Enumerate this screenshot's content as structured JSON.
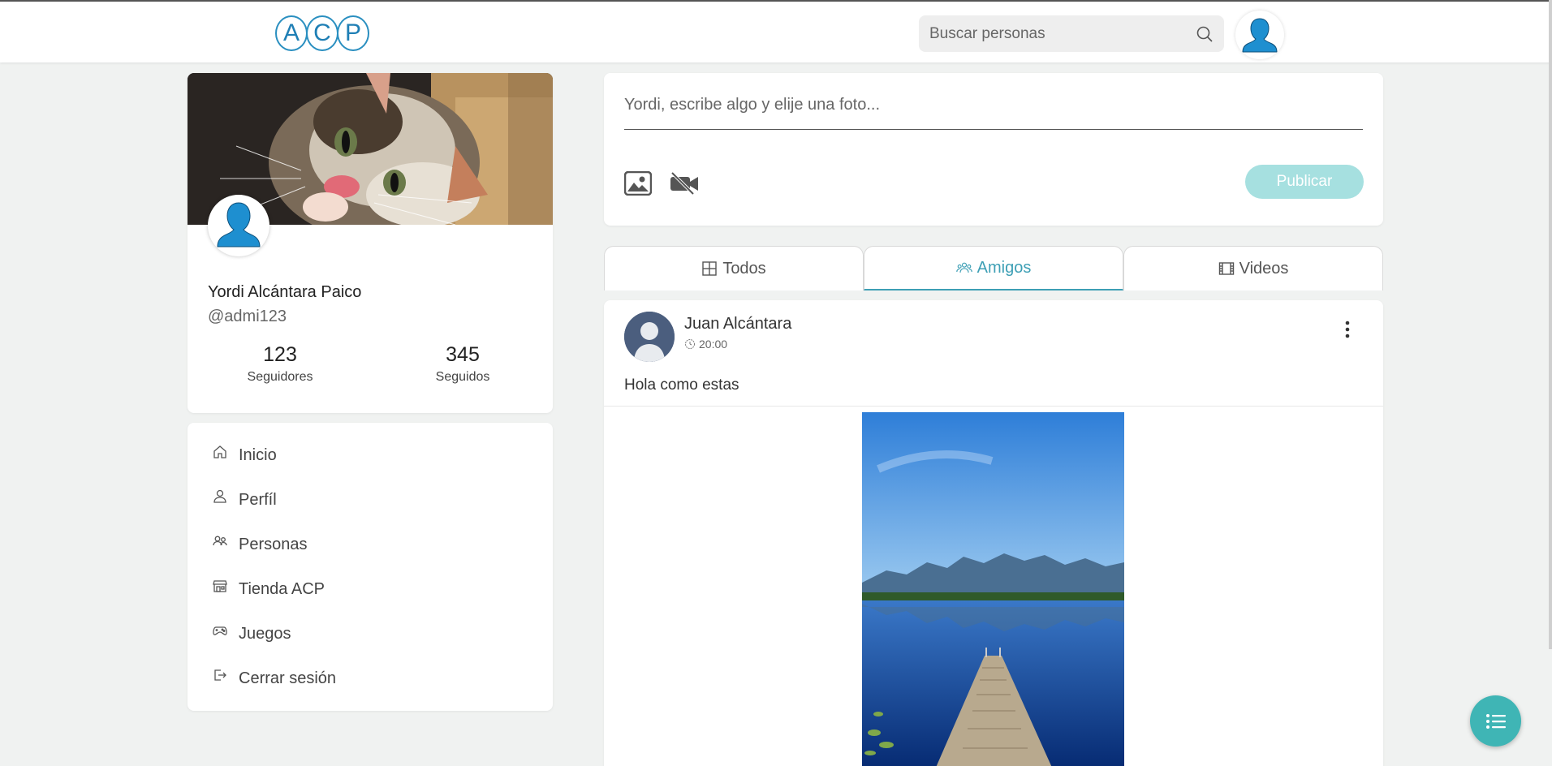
{
  "header": {
    "logo_letters": [
      "A",
      "C",
      "P"
    ],
    "search_placeholder": "Buscar personas"
  },
  "profile": {
    "name": "Yordi Alcántara Paico",
    "handle": "@admi123",
    "followers_count": "123",
    "followers_label": "Seguidores",
    "following_count": "345",
    "following_label": "Seguidos"
  },
  "menu": {
    "items": [
      {
        "label": "Inicio",
        "icon": "home-icon"
      },
      {
        "label": "Perfíl",
        "icon": "user-icon"
      },
      {
        "label": "Personas",
        "icon": "people-icon"
      },
      {
        "label": "Tienda ACP",
        "icon": "store-icon"
      },
      {
        "label": "Juegos",
        "icon": "gamepad-icon"
      },
      {
        "label": "Cerrar sesión",
        "icon": "logout-icon"
      }
    ]
  },
  "composer": {
    "placeholder": "Yordi, escribe algo y elije una foto...",
    "publish_label": "Publicar"
  },
  "tabs": [
    {
      "label": "Todos",
      "icon": "grid-icon",
      "active": false
    },
    {
      "label": "Amigos",
      "icon": "friends-icon",
      "active": true
    },
    {
      "label": "Videos",
      "icon": "film-icon",
      "active": false
    }
  ],
  "post": {
    "author": "Juan Alcántara",
    "time": "20:00",
    "text": "Hola como estas"
  },
  "colors": {
    "accent": "#3d9fb5",
    "publish_bg": "#a6e0e0",
    "fab_bg": "#3fb5b5",
    "logo": "#1f7fb5",
    "avatar_blue": "#1e8fd0"
  }
}
